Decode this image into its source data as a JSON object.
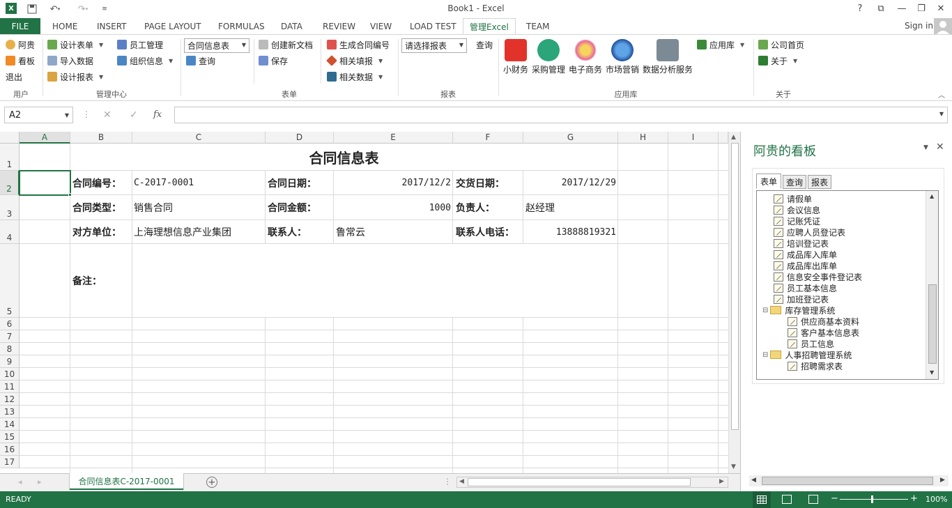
{
  "window": {
    "title": "Book1 - Excel"
  },
  "account": {
    "sign_in": "Sign in"
  },
  "tabs": [
    "FILE",
    "HOME",
    "INSERT",
    "PAGE LAYOUT",
    "FORMULAS",
    "DATA",
    "REVIEW",
    "VIEW",
    "LOAD TEST",
    "管理Excel",
    "TEAM"
  ],
  "active_tab": "管理Excel",
  "ribbon": {
    "user": {
      "items": [
        "阿贵",
        "看板",
        "退出"
      ],
      "label": "用户"
    },
    "mgmt": {
      "col1": [
        "设计表单",
        "导入数据",
        "设计报表"
      ],
      "col2": [
        "员工管理",
        "组织信息"
      ],
      "label": "管理中心"
    },
    "form": {
      "combo_value": "合同信息表",
      "query": "查询",
      "create_doc": "创建新文档",
      "save": "保存",
      "gen_no": "生成合同编号",
      "related_fill": "相关填报",
      "related_data": "相关数据",
      "label": "表单"
    },
    "report": {
      "combo_value": "请选择报表",
      "query": "查询",
      "label": "报表"
    },
    "apps": {
      "items": [
        "小财务",
        "采购管理",
        "电子商务",
        "市场营销",
        "数据分析服务"
      ],
      "store": "应用库",
      "label": "应用库"
    },
    "about": {
      "home": "公司首页",
      "about": "关于",
      "label": "关于"
    }
  },
  "formula_bar": {
    "name_box": "A2",
    "fx": "fx",
    "formula": ""
  },
  "grid": {
    "columns": [
      "A",
      "B",
      "C",
      "D",
      "E",
      "F",
      "G",
      "H",
      "I"
    ],
    "rows": [
      "1",
      "2",
      "3",
      "4",
      "5",
      "6",
      "7",
      "8",
      "9",
      "10",
      "11",
      "12",
      "13",
      "14",
      "15",
      "16",
      "17"
    ],
    "selected_cell": "A2",
    "title": "合同信息表",
    "contract_no_label": "合同编号：",
    "contract_no": "C-2017-0001",
    "contract_date_label": "合同日期：",
    "contract_date": "2017/12/2",
    "delivery_date_label": "交货日期：",
    "delivery_date": "2017/12/29",
    "contract_type_label": "合同类型：",
    "contract_type": "销售合同",
    "amount_label": "合同金额：",
    "amount": "1000",
    "owner_label": "负责人：",
    "owner": "赵经理",
    "party_label": "对方单位：",
    "party": "上海理想信息产业集团",
    "contact_label": "联系人：",
    "contact": "鲁常云",
    "phone_label": "联系人电话：",
    "phone": "13888819321",
    "remark_label": "备注："
  },
  "sheet_tab": "合同信息表C-2017-0001",
  "status": {
    "ready": "READY",
    "zoom": "100%"
  },
  "pane": {
    "title": "阿贵的看板",
    "tabs": [
      "表单",
      "查询",
      "报表"
    ],
    "tree": [
      {
        "label": "请假单",
        "level": 1,
        "type": "doc"
      },
      {
        "label": "会议信息",
        "level": 1,
        "type": "doc"
      },
      {
        "label": "记账凭证",
        "level": 1,
        "type": "doc"
      },
      {
        "label": "应聘人员登记表",
        "level": 1,
        "type": "doc"
      },
      {
        "label": "培训登记表",
        "level": 1,
        "type": "doc"
      },
      {
        "label": "成品库入库单",
        "level": 1,
        "type": "doc"
      },
      {
        "label": "成品库出库单",
        "level": 1,
        "type": "doc"
      },
      {
        "label": "信息安全事件登记表",
        "level": 1,
        "type": "doc"
      },
      {
        "label": "员工基本信息",
        "level": 1,
        "type": "doc"
      },
      {
        "label": "加班登记表",
        "level": 1,
        "type": "doc"
      },
      {
        "label": "库存管理系统",
        "level": 0,
        "type": "folder"
      },
      {
        "label": "供应商基本资料",
        "level": 2,
        "type": "doc"
      },
      {
        "label": "客户基本信息表",
        "level": 2,
        "type": "doc"
      },
      {
        "label": "员工信息",
        "level": 2,
        "type": "doc"
      },
      {
        "label": "人事招聘管理系统",
        "level": 0,
        "type": "folder"
      },
      {
        "label": "招聘需求表",
        "level": 2,
        "type": "doc"
      }
    ]
  },
  "colors": {
    "accent": "#217346"
  }
}
